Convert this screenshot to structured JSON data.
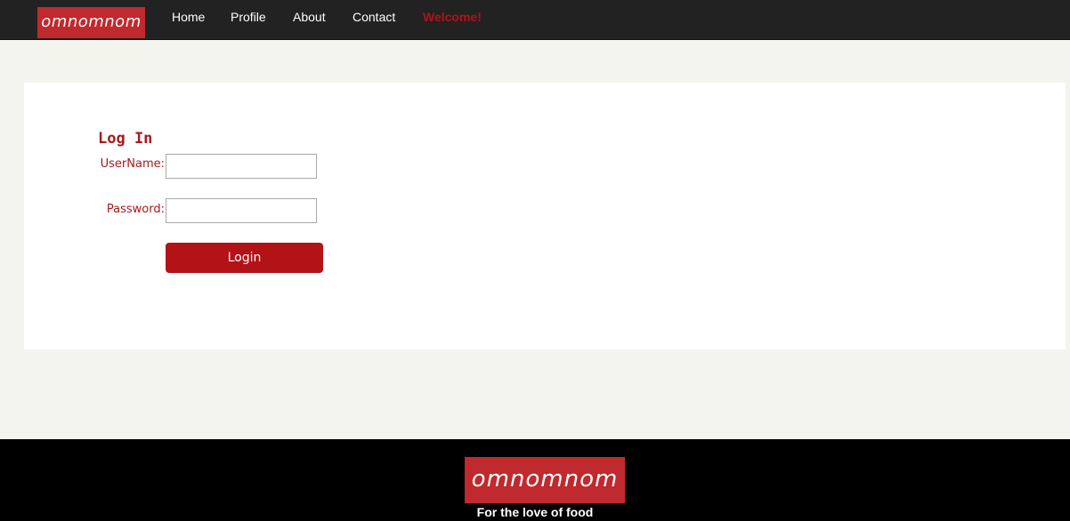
{
  "navbar": {
    "brand": "omnomnom",
    "links": [
      "Home",
      "Profile",
      "About",
      "Contact"
    ],
    "welcome": "Welcome!"
  },
  "login": {
    "title": "Log In",
    "username_label": "UserName:",
    "username_value": "",
    "password_label": "Password:",
    "password_value": "",
    "button_label": "Login"
  },
  "footer": {
    "brand": "omnomnom",
    "tagline": "For the love of food"
  },
  "colors": {
    "brand": "#c0292d",
    "accent": "#b31217",
    "navbar": "#222222",
    "footer": "#000000",
    "page_background": "#f4f4ef"
  }
}
